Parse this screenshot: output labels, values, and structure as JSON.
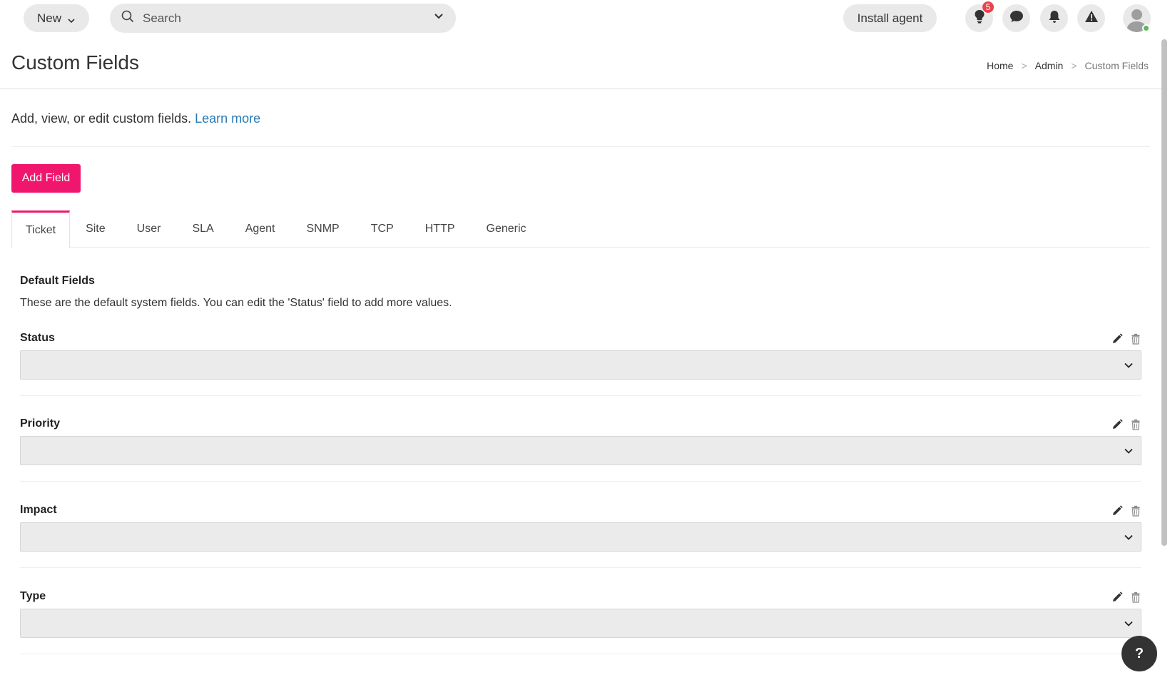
{
  "topbar": {
    "new_label": "New",
    "search_placeholder": "Search",
    "install_label": "Install agent",
    "tips_badge": "5"
  },
  "header": {
    "title": "Custom Fields",
    "breadcrumb": [
      "Home",
      "Admin",
      "Custom Fields"
    ],
    "breadcrumb_sep": ">"
  },
  "intro": {
    "text": "Add, view, or edit custom fields. ",
    "link": "Learn more"
  },
  "add_field_label": "Add Field",
  "tabs": [
    "Ticket",
    "Site",
    "User",
    "SLA",
    "Agent",
    "SNMP",
    "TCP",
    "HTTP",
    "Generic"
  ],
  "active_tab": "Ticket",
  "section": {
    "title": "Default Fields",
    "description": "These are the default system fields. You can edit the 'Status' field to add more values."
  },
  "fields": [
    {
      "label": "Status",
      "value": ""
    },
    {
      "label": "Priority",
      "value": ""
    },
    {
      "label": "Impact",
      "value": ""
    },
    {
      "label": "Type",
      "value": ""
    }
  ],
  "help_label": "?",
  "colors": {
    "accent": "#f0166e",
    "link": "#2a7ab8",
    "badge": "#e8434c",
    "online": "#5cb85c"
  }
}
